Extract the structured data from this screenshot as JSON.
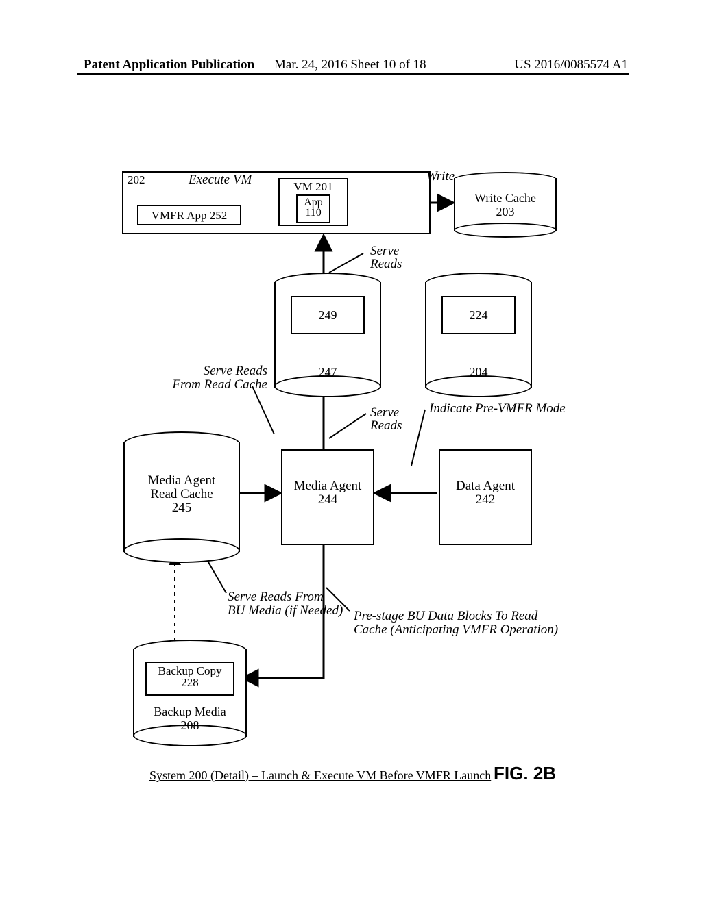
{
  "header": {
    "left": "Patent Application Publication",
    "mid": "Mar. 24, 2016  Sheet 10 of 18",
    "right": "US 2016/0085574 A1"
  },
  "host": {
    "ref": "202",
    "execute_vm_lbl": "Execute VM",
    "vmfr_app": "VMFR App 252",
    "vm": {
      "title": "VM 201",
      "app_line1": "App",
      "app_line2": "110"
    }
  },
  "write": {
    "lbl": "Write",
    "cache_line1": "Write Cache",
    "cache_line2": "203"
  },
  "serve_reads_top": {
    "line1": "Serve",
    "line2": "Reads"
  },
  "cyl247": {
    "inner": "249",
    "below": "247"
  },
  "cyl204": {
    "inner": "224",
    "below": "204"
  },
  "serve_reads_cache": {
    "line1": "Serve Reads",
    "line2": "From Read Cache"
  },
  "serve_reads_mid": {
    "line1": "Serve",
    "line2": "Reads"
  },
  "indicate_mode": "Indicate Pre-VMFR Mode",
  "read_cache": {
    "line1": "Media Agent",
    "line2": "Read Cache",
    "line3": "245"
  },
  "media_agent": {
    "line1": "Media Agent",
    "line2": "244"
  },
  "data_agent": {
    "line1": "Data Agent",
    "line2": "242"
  },
  "serve_bu": {
    "line1": "Serve Reads From",
    "line2": "BU Media (if Needed)"
  },
  "prestage": {
    "line1": "Pre-stage BU Data Blocks To Read",
    "line2": "Cache (Anticipating VMFR Operation)"
  },
  "backup": {
    "copy_line1": "Backup Copy",
    "copy_line2": "228",
    "media_line1": "Backup Media",
    "media_line2": "208"
  },
  "caption": "System 200 (Detail) – Launch & Execute VM Before VMFR Launch",
  "figure": "FIG. 2B"
}
